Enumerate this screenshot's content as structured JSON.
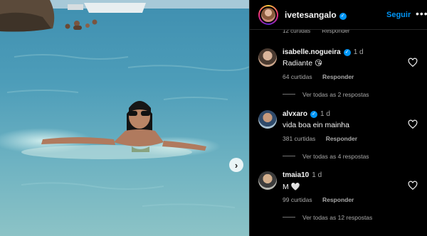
{
  "post": {
    "author": "ivetesangalo",
    "follow_label": "Seguir",
    "more_label": "•••",
    "next_arrow": "›",
    "partial_meta": {
      "likes": "12 curtidas",
      "reply": "Responder"
    }
  },
  "icons": {
    "verified": "verified-badge-icon",
    "heart": "heart-outline-icon",
    "next": "chevron-right-icon"
  },
  "colors": {
    "accent": "#0095f6",
    "background": "#000000",
    "muted": "#a8a8a8"
  },
  "comments": [
    {
      "user": "isabelle.nogueira",
      "time": "1 d",
      "text": "Radiante 😘",
      "likes": "64 curtidas",
      "reply": "Responder",
      "replies": "Ver todas as 2 respostas"
    },
    {
      "user": "alvxaro",
      "time": "1 d",
      "text": "vida boa ein mainha",
      "likes": "381 curtidas",
      "reply": "Responder",
      "replies": "Ver todas as 4 respostas"
    },
    {
      "user": "tmaia10",
      "time": "1 d",
      "text": "M 🤍",
      "likes": "99 curtidas",
      "reply": "Responder",
      "replies": "Ver todas as 12 respostas"
    }
  ]
}
